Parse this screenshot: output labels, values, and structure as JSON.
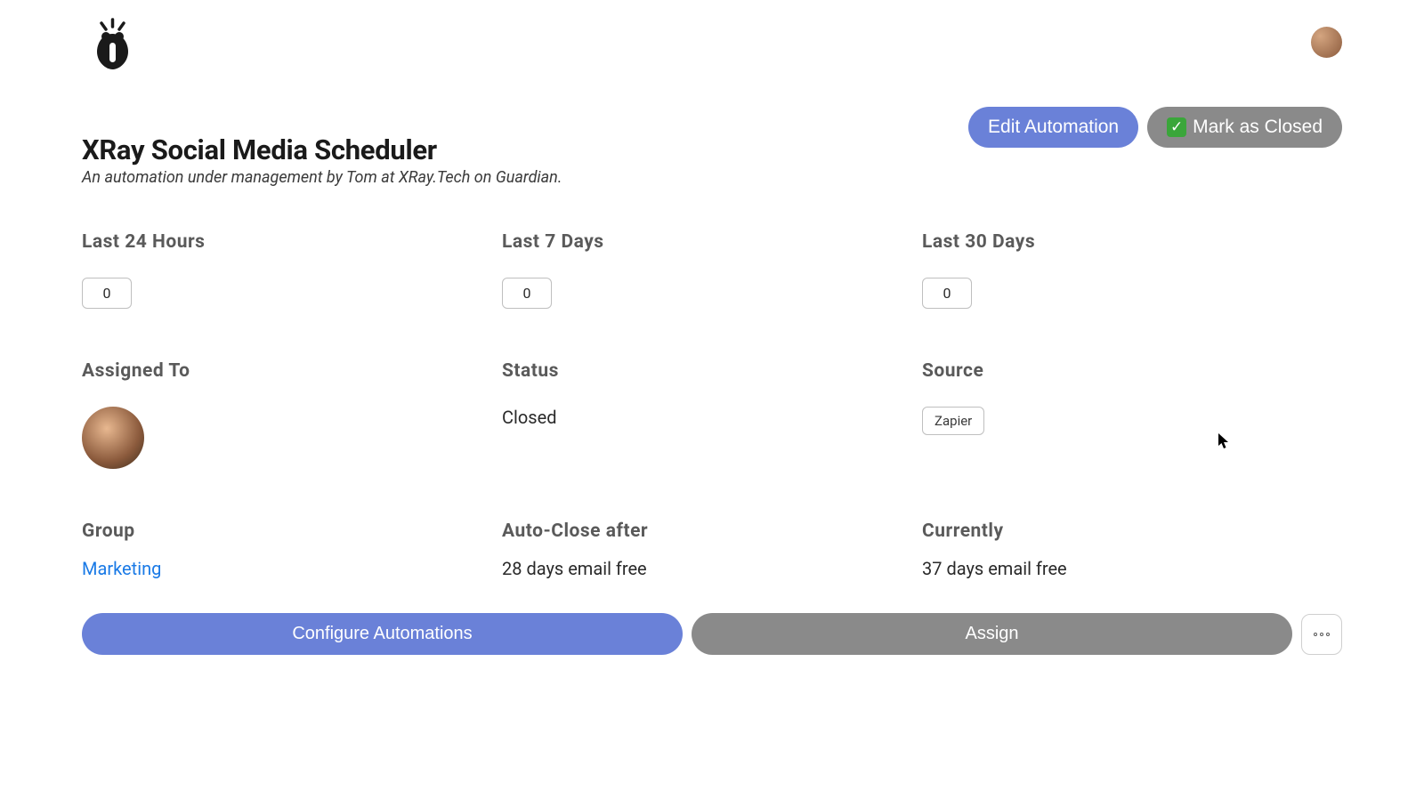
{
  "header": {
    "edit_button": "Edit Automation",
    "mark_closed_button": "Mark as Closed"
  },
  "title": "XRay Social Media Scheduler",
  "subtitle": "An automation under management by Tom at XRay.Tech on Guardian.",
  "stats": {
    "last_24h": {
      "label": "Last 24 Hours",
      "value": "0"
    },
    "last_7d": {
      "label": "Last 7 Days",
      "value": "0"
    },
    "last_30d": {
      "label": "Last 30 Days",
      "value": "0"
    }
  },
  "assigned_to": {
    "label": "Assigned To"
  },
  "status": {
    "label": "Status",
    "value": "Closed"
  },
  "source": {
    "label": "Source",
    "value": "Zapier"
  },
  "group": {
    "label": "Group",
    "value": "Marketing"
  },
  "auto_close": {
    "label": "Auto-Close after",
    "value": "28 days email free"
  },
  "currently": {
    "label": "Currently",
    "value": "37 days email free"
  },
  "bottom": {
    "configure": "Configure Automations",
    "assign": "Assign"
  }
}
